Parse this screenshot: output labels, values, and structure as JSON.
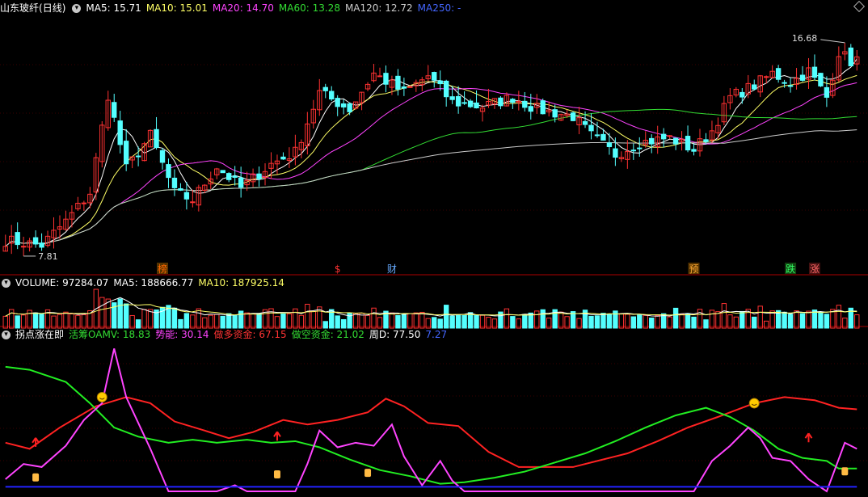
{
  "panels": {
    "price": {
      "stock_name": "山东玻纤",
      "period": "(日线)",
      "ma_labels": [
        {
          "text": "MA5: 15.71",
          "color": "#ffffff"
        },
        {
          "text": "MA10: 15.01",
          "color": "#ffff66"
        },
        {
          "text": "MA20: 14.70",
          "color": "#ff44ff"
        },
        {
          "text": "MA60: 13.28",
          "color": "#33dd33"
        },
        {
          "text": "MA120: 12.72",
          "color": "#cccccc"
        },
        {
          "text": "MA250: -",
          "color": "#4466ff"
        }
      ],
      "high_label": "16.68",
      "low_label": "7.81",
      "markers": [
        {
          "text": "榜",
          "color": "#ff6600",
          "bg": "#553300"
        },
        {
          "text": "$",
          "color": "#ff3333",
          "bg": ""
        },
        {
          "text": "财",
          "color": "#66aaff",
          "bg": ""
        },
        {
          "text": "预",
          "color": "#ffaa33",
          "bg": "#553300"
        },
        {
          "text": "跌",
          "color": "#33ff66",
          "bg": "#114411"
        },
        {
          "text": "涨",
          "color": "#ff6666",
          "bg": "#441111"
        }
      ]
    },
    "volume": {
      "labels": [
        {
          "text": "VOLUME: 97284.07",
          "color": "#ffffff"
        },
        {
          "text": "MA5: 188666.77",
          "color": "#ffffff"
        },
        {
          "text": "MA10: 187925.14",
          "color": "#ffff66"
        }
      ]
    },
    "indicator": {
      "labels": [
        {
          "text": "拐点涨在即",
          "color": "#ffffff"
        },
        {
          "text": "活筹OAMV: 18.83",
          "color": "#33dd33"
        },
        {
          "text": "势能: 30.14",
          "color": "#ff44ff"
        },
        {
          "text": "做多资金: 67.15",
          "color": "#ff3333"
        },
        {
          "text": "做空资金: 21.02",
          "color": "#33dd33"
        },
        {
          "text": "周D: 77.50",
          "color": "#ffffff"
        },
        {
          "text": "7.27",
          "color": "#4466ff"
        }
      ]
    }
  },
  "colors": {
    "up": "#ff3232",
    "down": "#54ffff",
    "bg": "#000000",
    "divider": "#aa0000"
  },
  "chart_data": [
    {
      "type": "candlestick",
      "title": "山东玻纤 (日线)",
      "count": 142,
      "ylim": [
        7.0,
        17.5
      ],
      "annotations": {
        "high": 16.68,
        "low": 7.81
      },
      "series": [
        {
          "name": "MA5",
          "value": 15.71
        },
        {
          "name": "MA10",
          "value": 15.01
        },
        {
          "name": "MA20",
          "value": 14.7
        },
        {
          "name": "MA60",
          "value": 13.28
        },
        {
          "name": "MA120",
          "value": 12.72
        }
      ],
      "anchors": [
        [
          0,
          8.1
        ],
        [
          6,
          7.9
        ],
        [
          10,
          8.9
        ],
        [
          14,
          10.1
        ],
        [
          17,
          14.2
        ],
        [
          20,
          11.1
        ],
        [
          24,
          12.5
        ],
        [
          28,
          10.1
        ],
        [
          31,
          9.8
        ],
        [
          35,
          11.2
        ],
        [
          39,
          10.3
        ],
        [
          44,
          11.3
        ],
        [
          48,
          11.8
        ],
        [
          52,
          14.3
        ],
        [
          57,
          13.6
        ],
        [
          61,
          15.1
        ],
        [
          66,
          14.3
        ],
        [
          70,
          15.0
        ],
        [
          74,
          13.9
        ],
        [
          79,
          13.7
        ],
        [
          84,
          14.1
        ],
        [
          88,
          13.6
        ],
        [
          94,
          13.3
        ],
        [
          97,
          12.5
        ],
        [
          101,
          11.7
        ],
        [
          105,
          12.2
        ],
        [
          110,
          12.4
        ],
        [
          114,
          11.9
        ],
        [
          117,
          12.7
        ],
        [
          120,
          14.1
        ],
        [
          124,
          14.6
        ],
        [
          127,
          15.1
        ],
        [
          130,
          14.7
        ],
        [
          133,
          15.2
        ],
        [
          136,
          14.1
        ],
        [
          138,
          16.0
        ],
        [
          140,
          15.6
        ],
        [
          141,
          15.7
        ]
      ],
      "ma_ends": {
        "MA5": 15.71,
        "MA10": 15.01,
        "MA20": 14.7,
        "MA60": 13.28,
        "MA120": 12.72
      }
    },
    {
      "type": "bar",
      "title": "VOLUME",
      "series": [
        {
          "name": "VOLUME",
          "last": 97284.07
        },
        {
          "name": "MA5",
          "last": 188666.77
        },
        {
          "name": "MA10",
          "last": 187925.14
        }
      ]
    },
    {
      "type": "line",
      "title": "拐点涨在即",
      "ylim": [
        0,
        100
      ],
      "series": [
        {
          "name": "做多资金",
          "color": "#ff2222",
          "points": [
            [
              0,
              32
            ],
            [
              4,
              28
            ],
            [
              9,
              42
            ],
            [
              15,
              56
            ],
            [
              20,
              62
            ],
            [
              24,
              58
            ],
            [
              28,
              46
            ],
            [
              33,
              40
            ],
            [
              37,
              35
            ],
            [
              41,
              39
            ],
            [
              46,
              47
            ],
            [
              50,
              44
            ],
            [
              55,
              47
            ],
            [
              60,
              52
            ],
            [
              63,
              61
            ],
            [
              66,
              56
            ],
            [
              70,
              45
            ],
            [
              75,
              43
            ],
            [
              80,
              26
            ],
            [
              85,
              16
            ],
            [
              89,
              16
            ],
            [
              94,
              16
            ],
            [
              98,
              20
            ],
            [
              103,
              25
            ],
            [
              108,
              33
            ],
            [
              113,
              42
            ],
            [
              118,
              49
            ],
            [
              124,
              58
            ],
            [
              129,
              62
            ],
            [
              134,
              60
            ],
            [
              138,
              55
            ],
            [
              141,
              54
            ]
          ]
        },
        {
          "name": "做空资金",
          "color": "#22ee22",
          "points": [
            [
              0,
              82
            ],
            [
              4,
              80
            ],
            [
              10,
              72
            ],
            [
              14,
              58
            ],
            [
              18,
              42
            ],
            [
              22,
              36
            ],
            [
              27,
              32
            ],
            [
              31,
              34
            ],
            [
              35,
              32
            ],
            [
              40,
              34
            ],
            [
              44,
              32
            ],
            [
              48,
              33
            ],
            [
              52,
              29
            ],
            [
              57,
              21
            ],
            [
              62,
              14
            ],
            [
              67,
              10
            ],
            [
              72,
              5
            ],
            [
              76,
              6
            ],
            [
              81,
              9
            ],
            [
              86,
              13
            ],
            [
              91,
              19
            ],
            [
              96,
              25
            ],
            [
              101,
              33
            ],
            [
              106,
              42
            ],
            [
              111,
              50
            ],
            [
              116,
              55
            ],
            [
              120,
              49
            ],
            [
              124,
              40
            ],
            [
              128,
              28
            ],
            [
              132,
              22
            ],
            [
              136,
              20
            ],
            [
              138,
              15
            ],
            [
              141,
              15
            ]
          ]
        },
        {
          "name": "势能",
          "color": "#ff44ff",
          "points": [
            [
              0,
              8
            ],
            [
              3,
              18
            ],
            [
              6,
              16
            ],
            [
              10,
              30
            ],
            [
              13,
              47
            ],
            [
              16,
              58
            ],
            [
              18,
              94
            ],
            [
              20,
              62
            ],
            [
              24,
              28
            ],
            [
              27,
              0
            ],
            [
              35,
              0
            ],
            [
              38,
              4
            ],
            [
              40,
              0
            ],
            [
              48,
              0
            ],
            [
              50,
              18
            ],
            [
              52,
              40
            ],
            [
              55,
              29
            ],
            [
              58,
              32
            ],
            [
              61,
              30
            ],
            [
              64,
              44
            ],
            [
              66,
              23
            ],
            [
              69,
              4
            ],
            [
              72,
              20
            ],
            [
              74,
              7
            ],
            [
              76,
              0
            ],
            [
              114,
              0
            ],
            [
              117,
              20
            ],
            [
              120,
              30
            ],
            [
              123,
              42
            ],
            [
              125,
              35
            ],
            [
              127,
              22
            ],
            [
              130,
              20
            ],
            [
              133,
              8
            ],
            [
              136,
              0
            ],
            [
              139,
              32
            ],
            [
              141,
              28
            ]
          ]
        },
        {
          "name": "7.27",
          "color": "#2222ff",
          "points": [
            [
              0,
              3
            ],
            [
              141,
              3
            ]
          ]
        }
      ]
    }
  ]
}
